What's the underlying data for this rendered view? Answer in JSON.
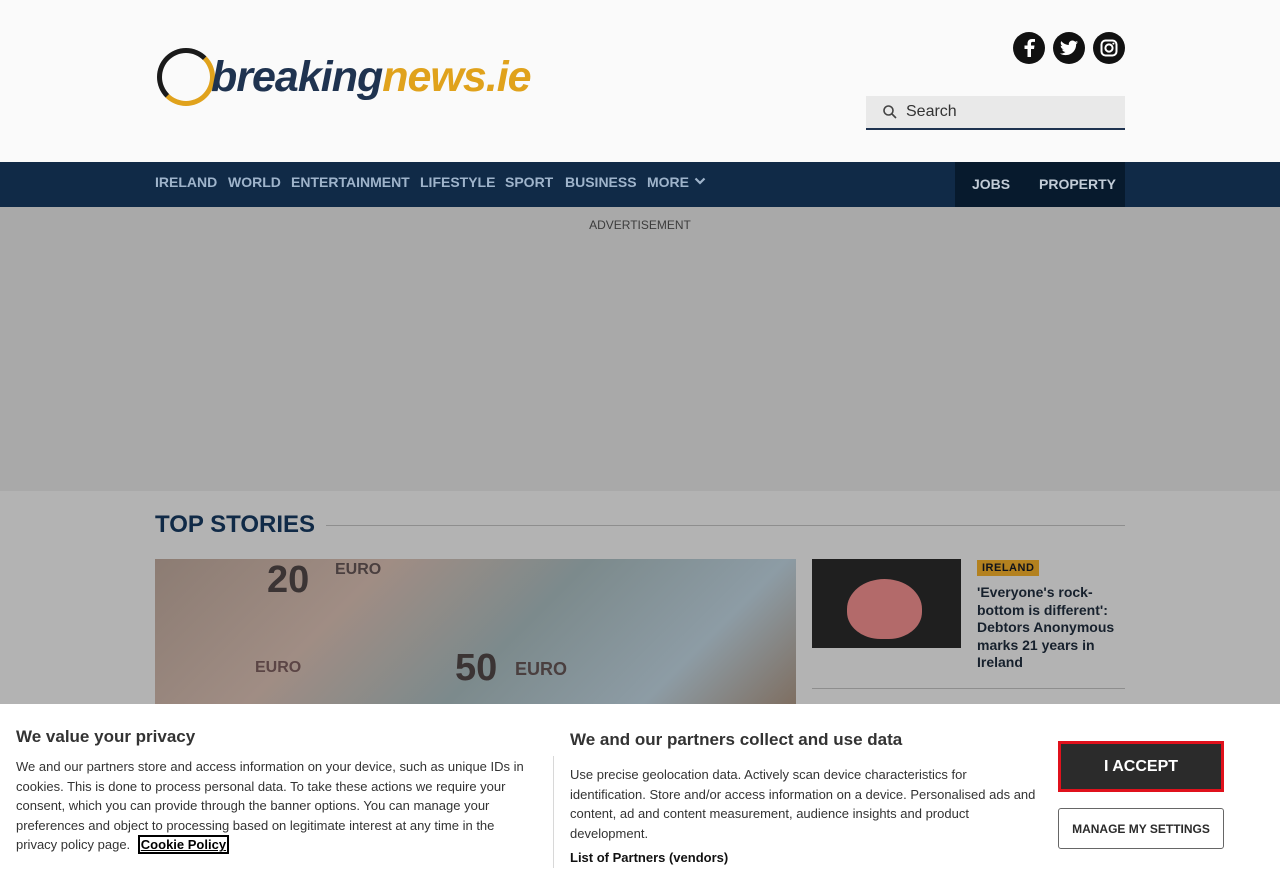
{
  "header": {
    "logo_part1": "breaking",
    "logo_part2": "news.ie",
    "social": [
      "facebook",
      "twitter",
      "instagram"
    ],
    "search_placeholder": "Search"
  },
  "nav": {
    "items": [
      "IRELAND",
      "WORLD",
      "ENTERTAINMENT",
      "LIFESTYLE",
      "SPORT",
      "BUSINESS",
      "MORE"
    ],
    "right": [
      "JOBS",
      "PROPERTY"
    ]
  },
  "ad_label": "ADVERTISEMENT",
  "top_stories": {
    "title": "TOP STORIES",
    "side_story": {
      "tag": "IRELAND",
      "headline": "'Everyone's rock-bottom is different': Debtors Anonymous marks 21 years in Ireland"
    }
  },
  "consent": {
    "left_title": "We value your privacy",
    "left_body": "We and our partners store and access information on your device, such as unique IDs in cookies. This is done to process personal data. To take these actions we require your consent, which you can provide through the banner options. You can manage your preferences and object to processing based on legitimate interest at any time in the privacy policy page.",
    "cookie_link": "Cookie Policy",
    "right_title": "We and our partners collect and use data",
    "right_body": "Use precise geolocation data. Actively scan device characteristics for identification. Store and/or access information on a device. Personalised ads and content, ad and content measurement, audience insights and product development.",
    "partners_link": "List of Partners (vendors)",
    "accept_label": "I ACCEPT",
    "manage_label": "MANAGE MY SETTINGS"
  }
}
